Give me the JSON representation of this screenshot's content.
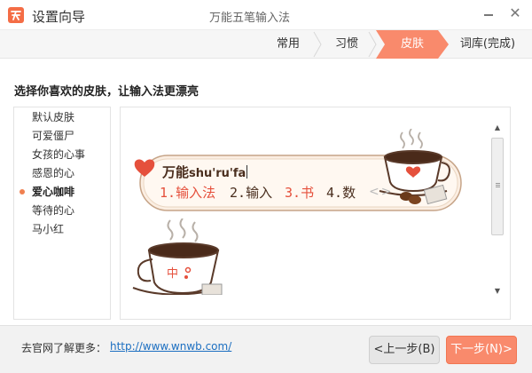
{
  "window": {
    "title": "设置向导",
    "product_name": "万能五笔输入法",
    "minimize_glyph": "—",
    "close_glyph": "✕"
  },
  "steps": [
    {
      "label": "常用",
      "active": false
    },
    {
      "label": "习惯",
      "active": false
    },
    {
      "label": "皮肤",
      "active": true
    },
    {
      "label": "词库(完成)",
      "active": false
    }
  ],
  "prompt": "选择你喜欢的皮肤，让输入法更漂亮",
  "skins": [
    {
      "label": "默认皮肤",
      "selected": false
    },
    {
      "label": "可爱僵尸",
      "selected": false
    },
    {
      "label": "女孩的心事",
      "selected": false
    },
    {
      "label": "感恩的心",
      "selected": false
    },
    {
      "label": "爱心咖啡",
      "selected": true
    },
    {
      "label": "等待的心",
      "selected": false
    },
    {
      "label": "马小红",
      "selected": false
    }
  ],
  "preview": {
    "composition_text": "万能",
    "composition_pinyin": "shu'ru'fa",
    "candidates": [
      {
        "index": "1.",
        "text": "输入法",
        "highlighted": true
      },
      {
        "index": "2.",
        "text": "输入",
        "highlighted": false
      },
      {
        "index": "3.",
        "text": "书",
        "highlighted": true
      },
      {
        "index": "4.",
        "text": "数",
        "highlighted": false
      }
    ],
    "page_arrows": "<>",
    "status_char": "中",
    "highlight_color": "#e5503c",
    "text_color": "#4a2e1e"
  },
  "footer": {
    "more_label": "去官网了解更多：",
    "link_text": "http://www.wnwb.com/",
    "prev_button": "<上一步(B)",
    "next_button": "下一步(N)>"
  },
  "colors": {
    "accent": "#f98a6c",
    "link": "#1c6fc1"
  },
  "icons": {
    "app_logo": "app-logo-icon",
    "heart": "heart-icon",
    "coffee_cup": "coffee-cup-icon",
    "scroll_up": "scroll-up-icon",
    "scroll_down": "scroll-down-icon"
  }
}
